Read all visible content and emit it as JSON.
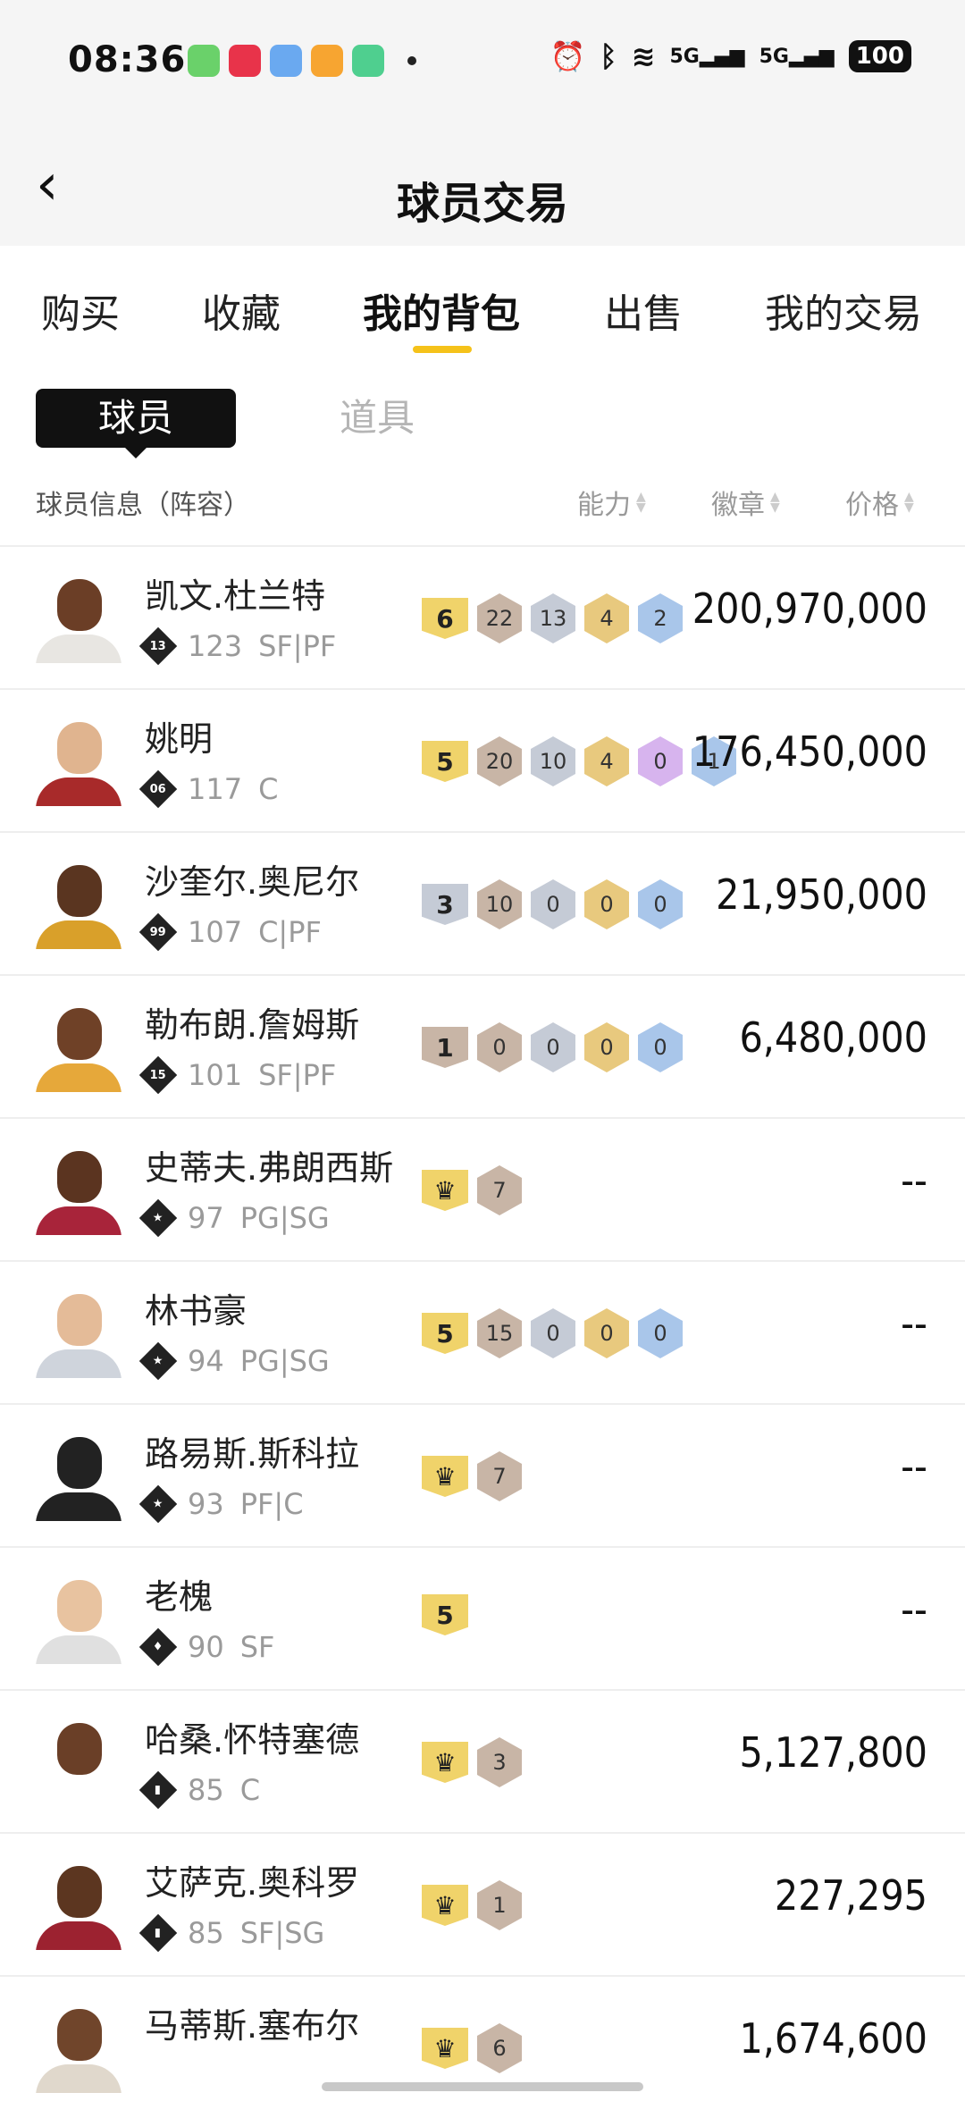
{
  "status_bar": {
    "time": "08:36",
    "battery": "100",
    "signal_1": "5G",
    "signal_2": "5G"
  },
  "header": {
    "title": "球员交易"
  },
  "tabs": [
    {
      "label": "购买",
      "active": false
    },
    {
      "label": "收藏",
      "active": false
    },
    {
      "label": "我的背包",
      "active": true
    },
    {
      "label": "出售",
      "active": false
    },
    {
      "label": "我的交易",
      "active": false
    }
  ],
  "segments": {
    "player": "球员",
    "item": "道具"
  },
  "columns": {
    "info": "球员信息（阵容）",
    "ability": "能力",
    "badge": "徽章",
    "price": "价格"
  },
  "colors": {
    "accent": "#f5c21a",
    "tier_gold": "#f0d36a",
    "badge_bronze": "#c8b5a6",
    "badge_silver": "#c5cbd6",
    "badge_gold": "#e8c97e",
    "badge_purple": "#d7b4ee",
    "badge_blue": "#a9c6ea"
  },
  "players": [
    {
      "name": "凯文.杜兰特",
      "number": "13",
      "rating": "123",
      "position": "SF|PF",
      "tier": "6",
      "badges": [
        "22",
        "13",
        "4",
        "2"
      ],
      "price": "200,970,000"
    },
    {
      "name": "姚明",
      "number": "06",
      "rating": "117",
      "position": "C",
      "tier": "5",
      "badges": [
        "20",
        "10",
        "4",
        "0",
        "1"
      ],
      "price": "176,450,000"
    },
    {
      "name": "沙奎尔.奥尼尔",
      "number": "99",
      "rating": "107",
      "position": "C|PF",
      "tier": "3",
      "badges": [
        "10",
        "0",
        "0",
        "0"
      ],
      "price": "21,950,000"
    },
    {
      "name": "勒布朗.詹姆斯",
      "number": "15",
      "rating": "101",
      "position": "SF|PF",
      "tier": "1",
      "badges": [
        "0",
        "0",
        "0",
        "0"
      ],
      "price": "6,480,000"
    },
    {
      "name": "史蒂夫.弗朗西斯",
      "number": "★",
      "rating": "97",
      "position": "PG|SG",
      "tier": "crown",
      "badges": [
        "7"
      ],
      "price": "--"
    },
    {
      "name": "林书豪",
      "number": "★",
      "rating": "94",
      "position": "PG|SG",
      "tier": "5",
      "badges": [
        "15",
        "0",
        "0",
        "0"
      ],
      "price": "--"
    },
    {
      "name": "路易斯.斯科拉",
      "number": "★",
      "rating": "93",
      "position": "PF|C",
      "tier": "crown",
      "badges": [
        "7"
      ],
      "price": "--"
    },
    {
      "name": "老槐",
      "number": "♦",
      "rating": "90",
      "position": "SF",
      "tier": "5",
      "badges": [],
      "price": "--"
    },
    {
      "name": "哈桑.怀特塞德",
      "number": "▮",
      "rating": "85",
      "position": "C",
      "tier": "crown",
      "badges": [
        "3"
      ],
      "price": "5,127,800"
    },
    {
      "name": "艾萨克.奥科罗",
      "number": "▮",
      "rating": "85",
      "position": "SF|SG",
      "tier": "crown",
      "badges": [
        "1"
      ],
      "price": "227,295"
    },
    {
      "name": "马蒂斯.塞布尔",
      "number": "▮",
      "rating": "",
      "position": "",
      "tier": "crown",
      "badges": [
        "6"
      ],
      "price": "1,674,600"
    }
  ]
}
